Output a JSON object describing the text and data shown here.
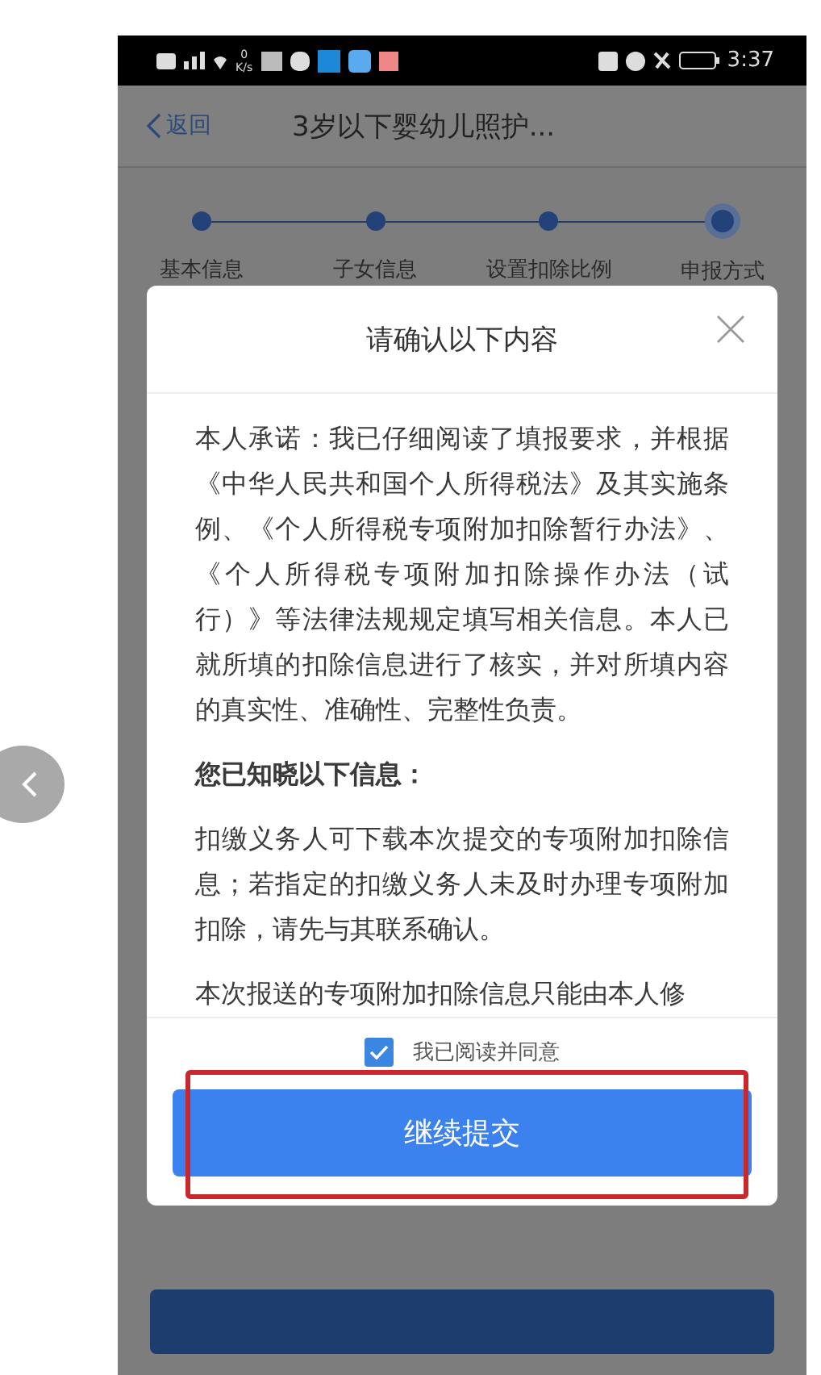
{
  "status_bar": {
    "speed_value": "0",
    "speed_unit": "K/s",
    "time": "3:37"
  },
  "header": {
    "back_label": "返回",
    "title": "3岁以下婴幼儿照护..."
  },
  "steps": [
    {
      "label": "基本信息",
      "selected": false
    },
    {
      "label": "子女信息",
      "selected": false
    },
    {
      "label": "设置扣除比例",
      "selected": false
    },
    {
      "label": "申报方式",
      "selected": true
    }
  ],
  "dialog": {
    "title": "请确认以下内容",
    "paragraphs": [
      {
        "kind": "body",
        "text": "本人承诺：我已仔细阅读了填报要求，并根据《中华人民共和国个人所得税法》及其实施条例、《个人所得税专项附加扣除暂行办法》、《个人所得税专项附加扣除操作办法（试行）》等法律法规规定填写相关信息。本人已就所填的扣除信息进行了核实，并对所填内容的真实性、准确性、完整性负责。"
      },
      {
        "kind": "heading",
        "text": "您已知晓以下信息："
      },
      {
        "kind": "body",
        "text": "扣缴义务人可下载本次提交的专项附加扣除信息；若指定的扣缴义务人未及时办理专项附加扣除，请先与其联系确认。"
      },
      {
        "kind": "body",
        "text": "本次报送的专项附加扣除信息只能由本人修"
      }
    ],
    "agree": {
      "label": "我已阅读并同意",
      "checked": true
    },
    "submit": {
      "label": "继续提交",
      "highlighted": true
    }
  }
}
